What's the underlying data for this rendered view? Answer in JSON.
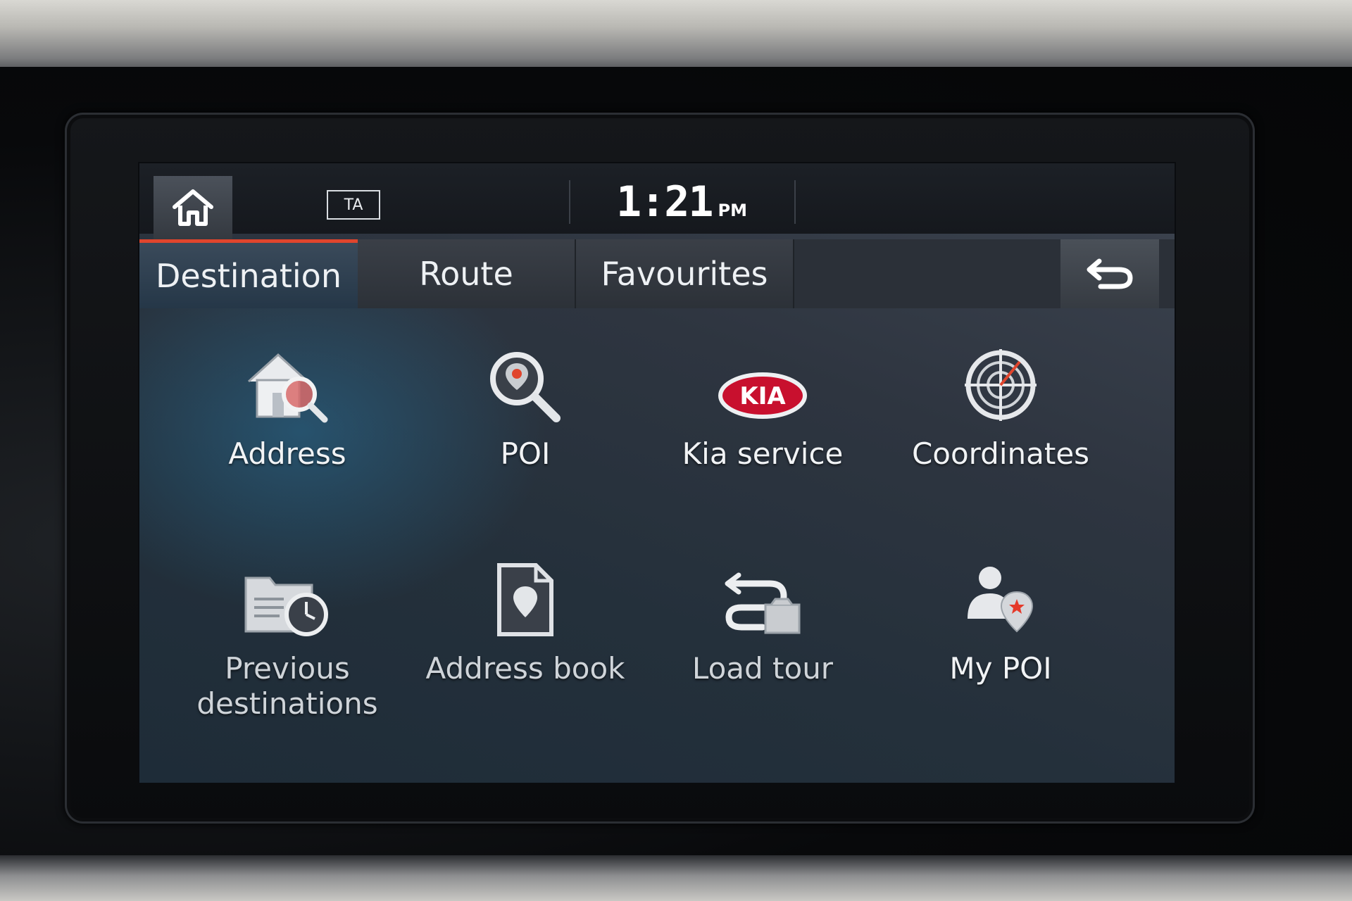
{
  "status_bar": {
    "ta_label": "TA",
    "time": "1:21",
    "ampm": "PM"
  },
  "tabs": [
    {
      "label": "Destination",
      "active": true
    },
    {
      "label": "Route",
      "active": false
    },
    {
      "label": "Favourites",
      "active": false
    }
  ],
  "menu": {
    "items": [
      {
        "label": "Address",
        "icon": "house-search-icon"
      },
      {
        "label": "POI",
        "icon": "poi-search-icon"
      },
      {
        "label": "Kia service",
        "icon": "kia-logo-icon"
      },
      {
        "label": "Coordinates",
        "icon": "crosshair-globe-icon"
      },
      {
        "label_line1": "Previous",
        "label_line2": "destinations",
        "icon": "folder-clock-icon"
      },
      {
        "label": "Address book",
        "icon": "address-book-icon"
      },
      {
        "label": "Load tour",
        "icon": "load-tour-icon"
      },
      {
        "label": "My POI",
        "icon": "person-pin-icon"
      }
    ]
  },
  "colors": {
    "active_tab_accent": "#e0452d",
    "kia_red": "#c8102e",
    "pin_red": "#e53a2a"
  }
}
